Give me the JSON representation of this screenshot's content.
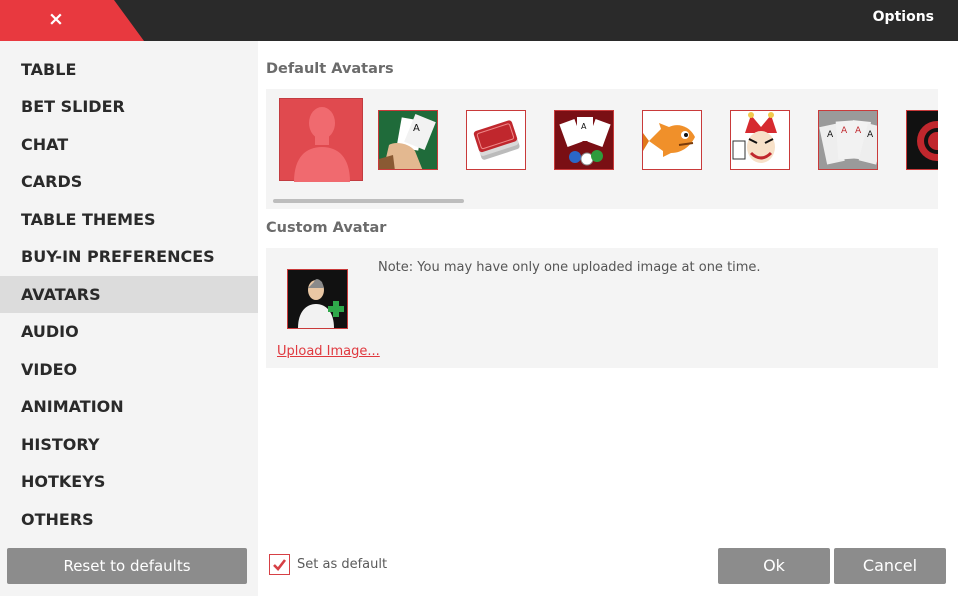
{
  "window": {
    "title": "Options",
    "close_label": "×"
  },
  "sidebar": {
    "items": [
      {
        "label": "TABLE"
      },
      {
        "label": "BET SLIDER"
      },
      {
        "label": "CHAT"
      },
      {
        "label": "CARDS"
      },
      {
        "label": "TABLE THEMES"
      },
      {
        "label": "BUY-IN PREFERENCES"
      },
      {
        "label": "AVATARS",
        "active": true
      },
      {
        "label": "AUDIO"
      },
      {
        "label": "VIDEO"
      },
      {
        "label": "ANIMATION"
      },
      {
        "label": "HISTORY"
      },
      {
        "label": "HOTKEYS"
      },
      {
        "label": "OTHERS"
      }
    ],
    "reset_label": "Reset to defaults"
  },
  "main": {
    "default_avatars_title": "Default Avatars",
    "avatars": [
      {
        "icon": "person-silhouette-icon",
        "selected": true
      },
      {
        "icon": "hand-holding-cards-icon"
      },
      {
        "icon": "card-deck-icon"
      },
      {
        "icon": "cards-and-chips-icon"
      },
      {
        "icon": "cartoon-fish-icon"
      },
      {
        "icon": "joker-icon"
      },
      {
        "icon": "four-aces-icon"
      },
      {
        "icon": "poker-chip-icon"
      }
    ],
    "custom_avatar_title": "Custom Avatar",
    "note": "Note: You may have only one uploaded image at one time.",
    "upload_link": "Upload Image..."
  },
  "footer": {
    "set_default_label": "Set as default",
    "set_default_checked": true,
    "ok_label": "Ok",
    "cancel_label": "Cancel"
  },
  "colors": {
    "accent": "#e8393f",
    "titlebar": "#2a2a2a",
    "button": "#8c8c8c",
    "sidebar_bg": "#f4f4f4",
    "active_item": "#dcdcdc"
  }
}
